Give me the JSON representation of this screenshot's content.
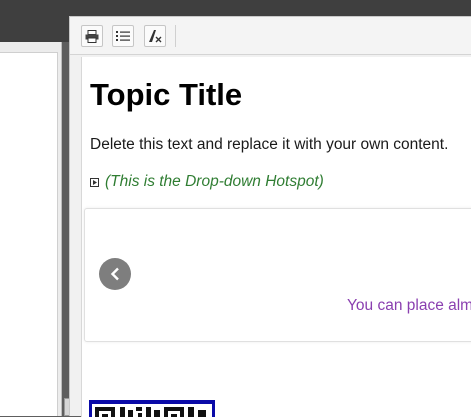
{
  "toolbar": {
    "buttons": [
      {
        "name": "print",
        "icon": "printer-icon"
      },
      {
        "name": "list",
        "icon": "list-icon"
      },
      {
        "name": "clear-formatting",
        "icon": "clear-format-icon"
      }
    ]
  },
  "content": {
    "title": "Topic Title",
    "body": "Delete this text and replace it with your own content.",
    "dropdown_hotspot": "(This is the Drop-down Hotspot)",
    "slideshow_text": "You can place alm"
  },
  "colors": {
    "hotspot": "#2f7d32",
    "slide_text": "#8a3fb0",
    "qr_border": "#0a0aa8"
  }
}
